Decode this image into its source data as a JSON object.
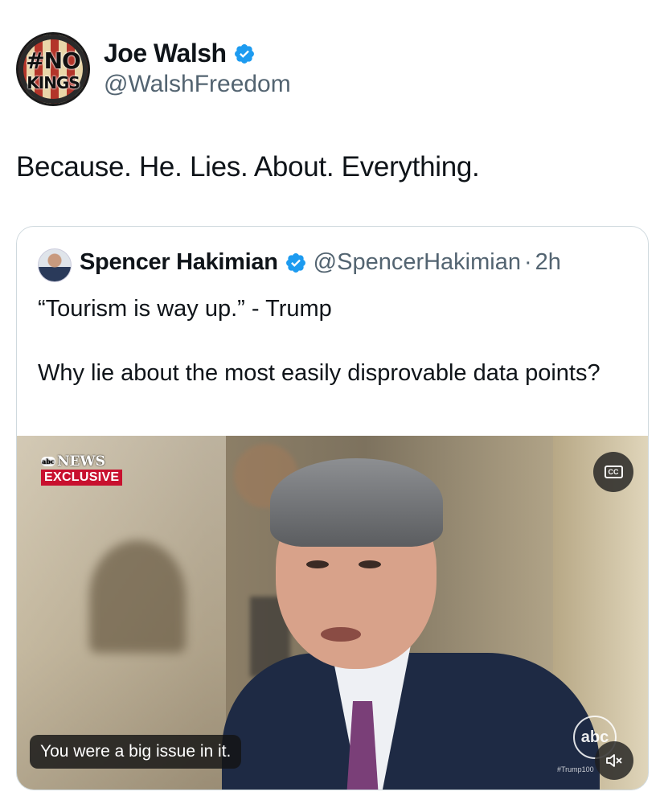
{
  "tweet": {
    "avatar": {
      "line1": "#NO",
      "line2": "KINGS"
    },
    "author_name": "Joe Walsh",
    "author_handle": "@WalshFreedom",
    "text": "Because. He. Lies. About. Everything."
  },
  "quoted_tweet": {
    "author_name": "Spencer Hakimian",
    "author_handle": "@SpencerHakimian",
    "separator": "·",
    "time": "2h",
    "paragraphs": [
      "“Tourism is way up.” - Trump",
      "Why lie about the most easily disprovable data points?"
    ],
    "video": {
      "news_label": "NEWS",
      "exclusive_label": "EXCLUSIVE",
      "cc_label": "CC",
      "caption": "You were a big issue in it.",
      "watermark": "abc",
      "hashtag": "#Trump100",
      "icons": [
        "closed-captions-icon",
        "speaker-muted-icon"
      ]
    }
  },
  "colors": {
    "verified_blue": "#1d9bf0",
    "secondary_text": "#536471",
    "exclusive_red": "#c8102e",
    "card_border": "#cfd9de"
  }
}
